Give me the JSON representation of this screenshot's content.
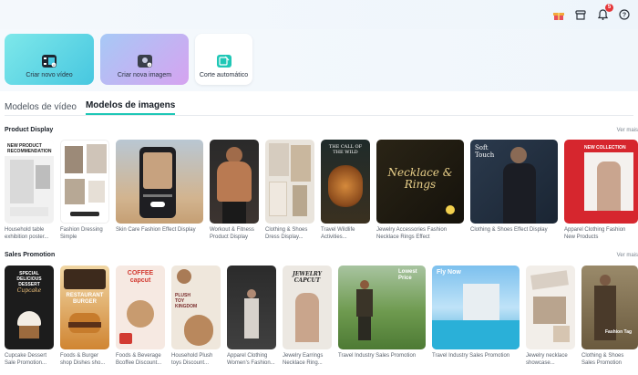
{
  "toolbar": {
    "notifications_count": "5",
    "icons": [
      "gift-icon",
      "store-icon",
      "bell-icon",
      "help-icon"
    ]
  },
  "actions": {
    "video_label": "Criar novo vídeo",
    "image_label": "Criar nova imagem",
    "cut_label": "Corte automático"
  },
  "tabs": [
    {
      "label": "Modelos de vídeo",
      "active": false
    },
    {
      "label": "Modelos de imagens",
      "active": true
    }
  ],
  "sections": [
    {
      "title": "Product Display",
      "see_more": "Ver mais",
      "items": [
        {
          "caption": "Household table exhibition poster..."
        },
        {
          "caption": "Fashion Dressing Simple Information..."
        },
        {
          "caption": "Skin Care Fashion Effect Display"
        },
        {
          "caption": "Workout & Fitness Product Display"
        },
        {
          "caption": "Clothing & Shoes Dress Display..."
        },
        {
          "caption": "Travel Wildlife Activities..."
        },
        {
          "caption": "Jewelry Accessories Fashion Necklace Rings Effect"
        },
        {
          "caption": "Clothing & Shoes Effect Display"
        },
        {
          "caption": "Apparel Clothing Fashion New Products"
        }
      ]
    },
    {
      "title": "Sales Promotion",
      "see_more": "Ver mais",
      "items": [
        {
          "caption": "Cupcake Dessert Sale Promotion..."
        },
        {
          "caption": "Foods & Burger shop Dishes sho..."
        },
        {
          "caption": "Foods & Beverage Bcoffee Discount..."
        },
        {
          "caption": "Household Plush toys Discount..."
        },
        {
          "caption": "Apparel Clothing Women's Fashion..."
        },
        {
          "caption": "Jewelry Earrings Necklace Ring..."
        },
        {
          "caption": "Travel Industry Sales Promotion"
        },
        {
          "caption": "Travel Industry Sales Promotion"
        },
        {
          "caption": "Jewelry necklace showcase..."
        },
        {
          "caption": "Clothing & Shoes Sales Promotion"
        }
      ]
    }
  ],
  "thumb_text": {
    "new_product": "NEW PRODUCT RECOMMENDATION",
    "call_of_wild": "THE CALL OF THE WILD",
    "necklace": "Necklace & Rings",
    "soft_touch": "Soft Touch",
    "new_collection": "NEW COLLECTION",
    "dessert": "SPECIAL DELICIOUS DESSERT",
    "cupcake": "Cupcake",
    "burger": "RESTAURANT BURGER",
    "coffee": "COFFEE capcut",
    "plush": "PLUSH TOY KINGDOM",
    "jewelry": "JEWELRY CAPCUT",
    "lowest_price": "Lowest Price",
    "fly_now": "Fly Now",
    "fashion_tag": "Fashion Tag"
  }
}
